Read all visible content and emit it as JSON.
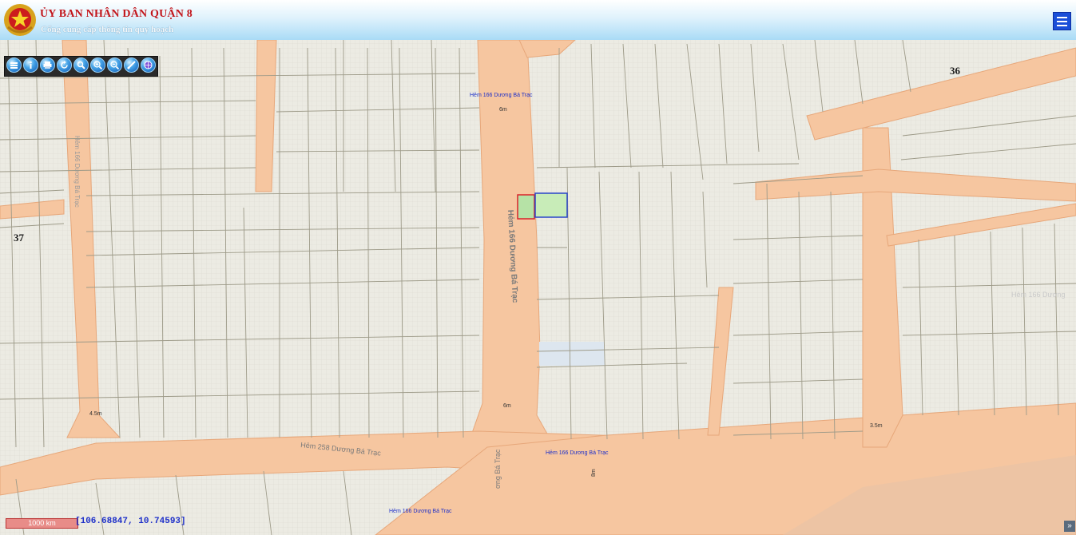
{
  "header": {
    "title": "ỦY BAN NHÂN DÂN QUẬN 8",
    "subtitle": "Cổng cung cấp thông tin quy hoạch"
  },
  "toolbar": {
    "tools": [
      "layers-icon",
      "info-icon",
      "print-icon",
      "refresh-icon",
      "search-icon",
      "zoom-in-icon",
      "zoom-out-icon",
      "measure-icon",
      "globe-icon"
    ]
  },
  "map": {
    "block_labels": [
      "36",
      "37"
    ],
    "road_labels": {
      "hem166_top": "Hẻm 166 Dương Bá Trạc",
      "hem166_vertical": "Hẻm 166 Dương Bá Trạc",
      "hem166_lower": "Hẻm 166 Dương Bá Trạc",
      "hem166_bottom": "Hẻm 166 Dương Bá Trạc",
      "hem258": "Hẻm 258 Dương Bá Trạc",
      "west_road": "Hẻm 166 Dương Bá Trạc",
      "east_faded": "Hẻm 166 Dương",
      "bottom_vertical": "ơng Bá Trạc"
    },
    "widths": {
      "w6m_top": "6m",
      "w6m_bottom": "6m",
      "w45m": "4.5m",
      "w35m": "3.5m",
      "w8m": "8m"
    },
    "colors": {
      "road": "#f6c6a0",
      "road_edge": "#e7a77a",
      "parcel_bg": "#ecebe3",
      "parcel_line": "#9d9a88",
      "selected_red": "#d9232a",
      "selected_blue": "#2944c9",
      "selected_fill": "#b6e2a6"
    }
  },
  "footer": {
    "scale": "1000 km",
    "coordinates": "[106.68847, 10.74593]",
    "expand_label": "»"
  }
}
